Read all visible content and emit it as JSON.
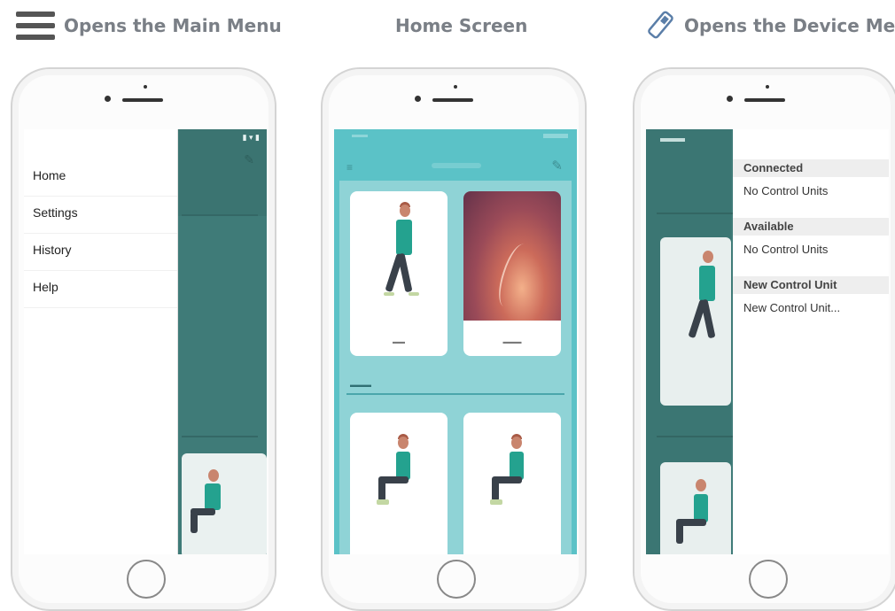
{
  "captions": {
    "main_menu": "Opens the Main Menu",
    "home_screen": "Home Screen",
    "device_menu": "Opens the Device Menu"
  },
  "main_menu": {
    "items": [
      {
        "label": "Home"
      },
      {
        "label": "Settings"
      },
      {
        "label": "History"
      },
      {
        "label": "Help"
      }
    ]
  },
  "device_menu": {
    "sections": [
      {
        "title": "Connected",
        "item": "No Control Units"
      },
      {
        "title": "Available",
        "item": "No Control Units"
      },
      {
        "title": "New Control Unit",
        "item": "New Control Unit..."
      }
    ]
  },
  "colors": {
    "teal_dark": "#3f7b78",
    "teal_light": "#5bc2c7",
    "caption_gray": "#7a7f86"
  },
  "icons": [
    "hamburger-icon",
    "usb-icon",
    "menu-icon",
    "bluetooth-icon"
  ]
}
